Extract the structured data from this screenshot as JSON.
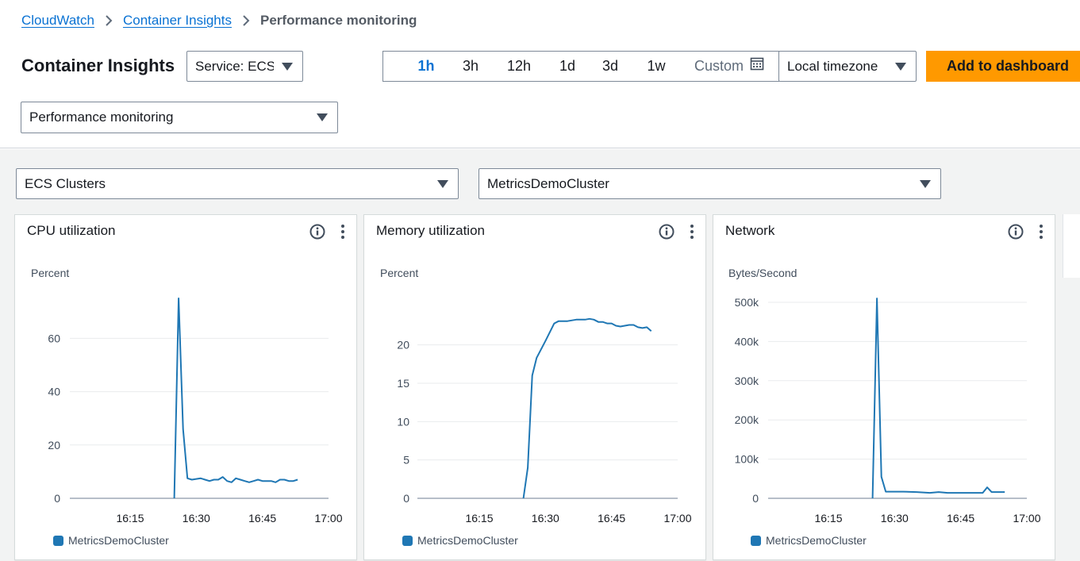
{
  "breadcrumb": {
    "items": [
      "CloudWatch",
      "Container Insights"
    ],
    "current": "Performance monitoring"
  },
  "header": {
    "title": "Container Insights",
    "service_select": "Service: ECS",
    "view_select": "Performance monitoring"
  },
  "time_range": {
    "options": [
      "1h",
      "3h",
      "12h",
      "1d",
      "3d",
      "1w"
    ],
    "active": "1h",
    "custom_label": "Custom",
    "timezone": "Local timezone"
  },
  "actions": {
    "add_to_dashboard": "Add to dashboard"
  },
  "filters": {
    "resource_type": "ECS Clusters",
    "cluster": "MetricsDemoCluster"
  },
  "colors": {
    "series": "#1f77b4",
    "accent": "#ff9900",
    "link": "#0972d3"
  },
  "chart_data": [
    {
      "type": "line",
      "title": "CPU utilization",
      "ylabel": "Percent",
      "ylim": [
        0,
        75
      ],
      "yticks": [
        0,
        20,
        40,
        60
      ],
      "ytick_labels": [
        "0",
        "20",
        "40",
        "60"
      ],
      "xlim": [
        0,
        53
      ],
      "xticks": [
        15,
        30,
        45,
        60
      ],
      "xtick_labels": [
        "16:15",
        "16:30",
        "16:45",
        "17:00"
      ],
      "grid": true,
      "legend": "bottom-left",
      "series": [
        {
          "name": "MetricsDemoCluster",
          "x": [
            25,
            26,
            27,
            28,
            29,
            31,
            32,
            33,
            34,
            35,
            36,
            37,
            38,
            39,
            40,
            41,
            42,
            43,
            44,
            45,
            46,
            47,
            48,
            49,
            50,
            51,
            52,
            53
          ],
          "y": [
            0,
            75,
            26,
            7.5,
            7,
            7.5,
            7,
            6.5,
            7,
            7,
            8,
            6.5,
            6,
            7.5,
            7,
            6.5,
            6,
            6.5,
            7,
            6.5,
            6.5,
            6.5,
            6,
            7,
            7,
            6.5,
            6.5,
            7
          ]
        }
      ]
    },
    {
      "type": "line",
      "title": "Memory utilization",
      "ylabel": "Percent",
      "ylim": [
        0,
        24
      ],
      "yticks": [
        0,
        5,
        10,
        15,
        20
      ],
      "ytick_labels": [
        "0",
        "5",
        "10",
        "15",
        "20"
      ],
      "xlim": [
        0,
        54
      ],
      "xticks": [
        15,
        30,
        45,
        60
      ],
      "xtick_labels": [
        "16:15",
        "16:30",
        "16:45",
        "17:00"
      ],
      "grid": true,
      "legend": "bottom-left",
      "series": [
        {
          "name": "MetricsDemoCluster",
          "x": [
            25,
            26,
            27,
            28,
            30,
            32,
            33,
            35,
            37,
            39,
            40,
            41,
            42,
            43,
            44,
            45,
            46,
            47,
            48,
            49,
            50,
            51,
            52,
            53,
            54
          ],
          "y": [
            0,
            4,
            16,
            18.3,
            20.5,
            22.8,
            23.1,
            23.1,
            23.3,
            23.3,
            23.4,
            23.3,
            23.0,
            23.0,
            22.8,
            22.8,
            22.5,
            22.4,
            22.5,
            22.6,
            22.6,
            22.3,
            22.2,
            22.3,
            21.8
          ]
        }
      ]
    },
    {
      "type": "line",
      "title": "Network",
      "ylabel": "Bytes/Second",
      "ylim": [
        0,
        500000
      ],
      "yticks": [
        0,
        100000,
        200000,
        300000,
        400000,
        500000
      ],
      "ytick_labels": [
        "0",
        "100k",
        "200k",
        "300k",
        "400k",
        "500k"
      ],
      "xlim": [
        0,
        53
      ],
      "xticks": [
        15,
        30,
        45,
        60
      ],
      "xtick_labels": [
        "16:15",
        "16:30",
        "16:45",
        "17:00"
      ],
      "grid": true,
      "legend": "bottom-left",
      "series": [
        {
          "name": "MetricsDemoCluster",
          "x": [
            25,
            26,
            27,
            28,
            32,
            35,
            38,
            40,
            42,
            45,
            50,
            51,
            52,
            55
          ],
          "y": [
            0,
            510000,
            55000,
            17000,
            17000,
            16000,
            14000,
            16000,
            14000,
            14000,
            14000,
            28000,
            16000,
            16000
          ]
        }
      ]
    }
  ]
}
